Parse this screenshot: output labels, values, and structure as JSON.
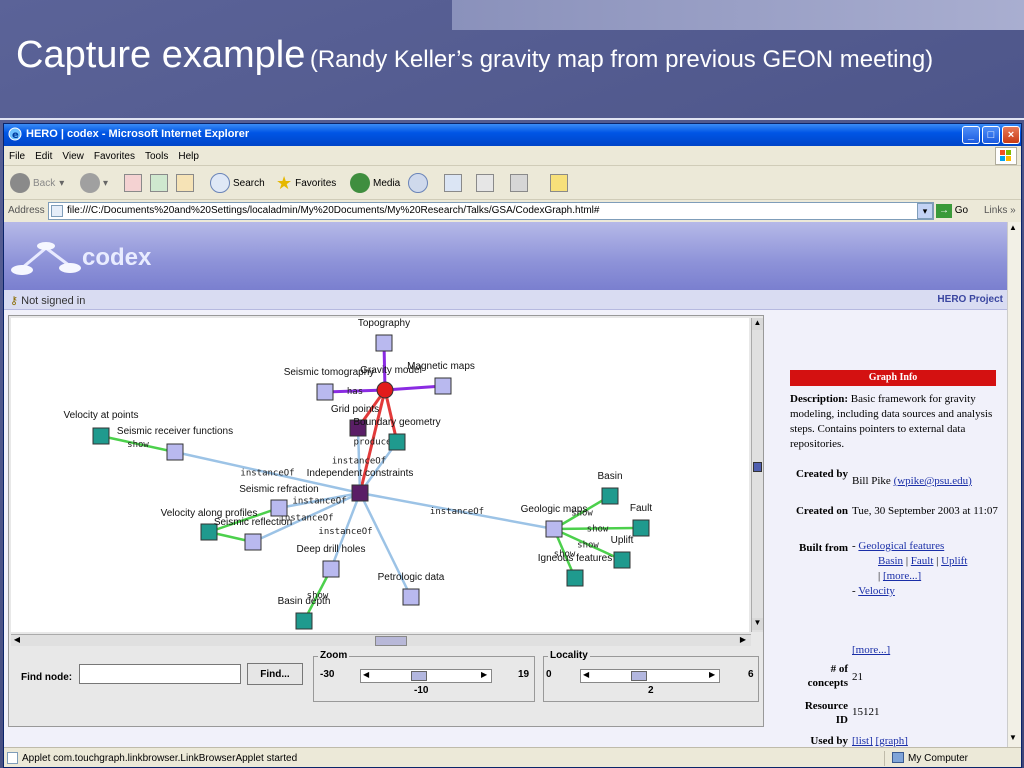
{
  "slide": {
    "title_main": "Capture example",
    "title_sub": "(Randy Keller’s gravity map from previous GEON meeting)"
  },
  "window": {
    "title": "HERO | codex - Microsoft Internet Explorer"
  },
  "menu": [
    "File",
    "Edit",
    "View",
    "Favorites",
    "Tools",
    "Help"
  ],
  "toolbar": {
    "back": "Back",
    "search": "Search",
    "favorites": "Favorites",
    "media": "Media"
  },
  "address": {
    "label": "Address",
    "url": "file:///C:/Documents%20and%20Settings/localadmin/My%20Documents/My%20Research/Talks/GSA/CodexGraph.html#",
    "go": "Go",
    "links": "Links"
  },
  "codex": {
    "logo": "codex",
    "signin": "Not signed in",
    "project": "HERO Project"
  },
  "graph": {
    "nodes": [
      {
        "label": "Topography"
      },
      {
        "label": "Seismic tomography"
      },
      {
        "label": "Gravity model"
      },
      {
        "label": "Magnetic maps"
      },
      {
        "label": "Grid points"
      },
      {
        "label": "Boundary geometry"
      },
      {
        "label": "Velocity at points"
      },
      {
        "label": "Seismic receiver functions"
      },
      {
        "label": "Independent constraints"
      },
      {
        "label": "Seismic refraction"
      },
      {
        "label": "Velocity along profiles"
      },
      {
        "label": "Seismic reflection"
      },
      {
        "label": "Deep drill holes"
      },
      {
        "label": "Basin depth"
      },
      {
        "label": "Petrologic data"
      },
      {
        "label": "Geologic maps"
      },
      {
        "label": "Basin"
      },
      {
        "label": "Fault"
      },
      {
        "label": "Uplift"
      },
      {
        "label": "Igneous features"
      }
    ],
    "edge_labels": {
      "has": "has",
      "instance_of": "instanceOf",
      "produce": "produce",
      "show": "show"
    }
  },
  "controls": {
    "find_label": "Find node:",
    "find_button": "Find...",
    "zoom": {
      "title": "Zoom",
      "min": "-30",
      "max": "19",
      "value": "-10"
    },
    "locality": {
      "title": "Locality",
      "min": "0",
      "max": "6",
      "value": "2"
    }
  },
  "info": {
    "header": "Graph Info",
    "description_label": "Description:",
    "description": "Basic framework for gravity modeling, including data sources and analysis steps. Contains pointers to external data repositories.",
    "created_by_label": "Created by",
    "created_by_name": "Bill Pike",
    "created_by_email": "(wpike@psu.edu)",
    "created_on_label": "Created on",
    "created_on": "Tue, 30 September 2003 at 11:07",
    "built_from_label": "Built from",
    "built_from_1": "Geological features",
    "built_from_sub": [
      "Basin",
      "Fault",
      "Uplift"
    ],
    "more_inline": "[more...]",
    "built_from_2": "Velocity",
    "more": "[more...]",
    "concepts_label": "# of concepts",
    "concepts": "21",
    "resource_label": "Resource ID",
    "resource": "15121",
    "used_by_label": "Used by",
    "used_by_list": "[list]",
    "used_by_graph": "[graph]"
  },
  "status": {
    "text": "Applet com.touchgraph.linkbrowser.LinkBrowserApplet started",
    "zone": "My Computer"
  }
}
